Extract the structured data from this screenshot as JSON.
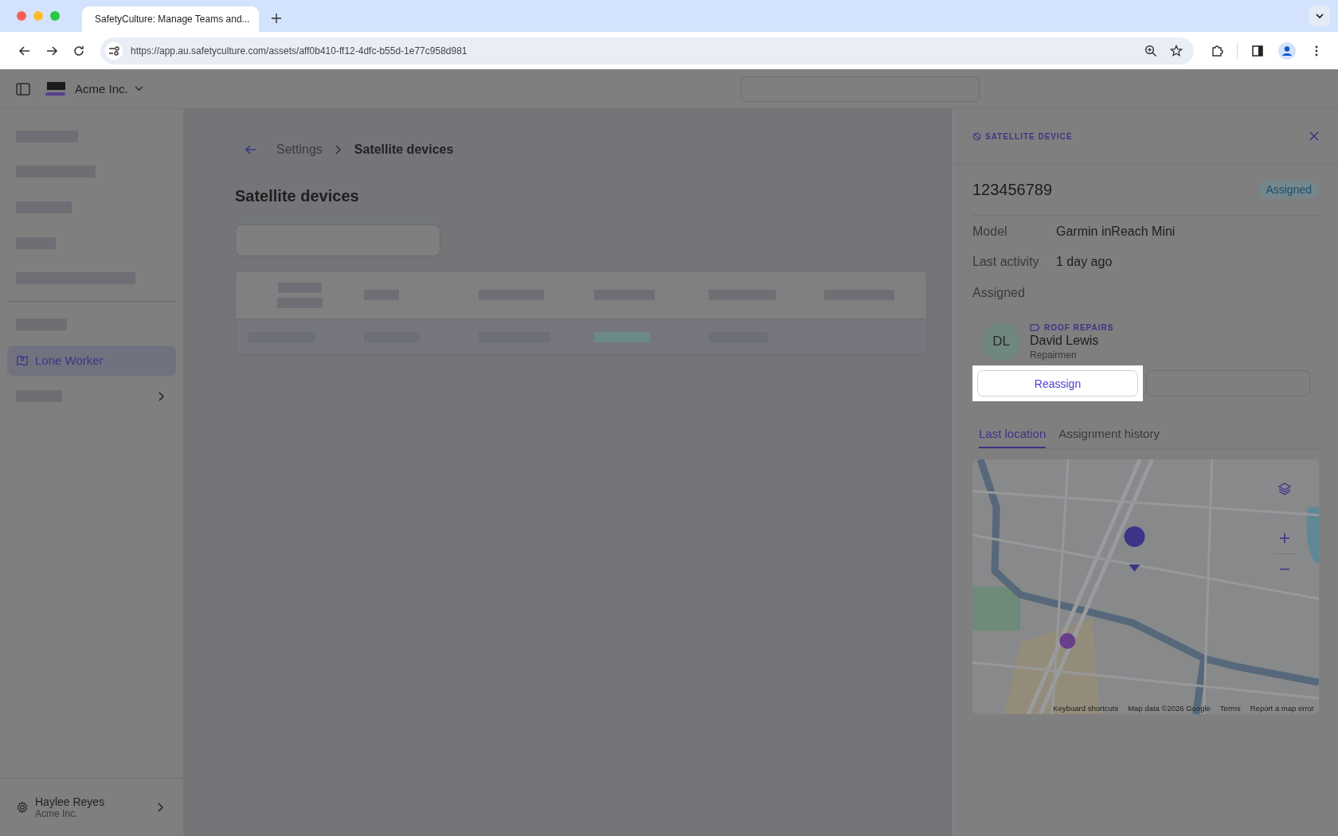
{
  "browser": {
    "tab_title": "SafetyCulture: Manage Teams and...",
    "url": "https://app.au.safetyculture.com/assets/aff0b410-ff12-4dfc-b55d-1e77c958d981"
  },
  "app_header": {
    "org": "Acme Inc."
  },
  "sidebar": {
    "items": [
      {
        "kind": "skeleton"
      },
      {
        "kind": "skeleton"
      },
      {
        "kind": "skeleton"
      },
      {
        "kind": "skeleton"
      },
      {
        "kind": "skeleton"
      },
      {
        "kind": "divider"
      },
      {
        "kind": "skeleton"
      },
      {
        "kind": "nav",
        "label": "Lone Worker",
        "selected": true
      },
      {
        "kind": "skeleton-expand"
      }
    ],
    "user": {
      "name": "Haylee Reyes",
      "org": "Acme Inc."
    }
  },
  "breadcrumb": [
    "Settings",
    "Satellite devices"
  ],
  "page_title": "Satellite devices",
  "panel": {
    "kicker": "SATELLITE DEVICE",
    "device_id": "123456789",
    "status": "Assigned",
    "fields": [
      {
        "label": "Model",
        "value": "Garmin inReach Mini"
      },
      {
        "label": "Last activity",
        "value": "1 day ago"
      }
    ],
    "assigned_heading": "Assigned",
    "assignee": {
      "initials": "DL",
      "group": "ROOF REPAIRS",
      "name": "David Lewis",
      "role": "Repairmen"
    },
    "primary_button": "Reassign",
    "tabs": [
      {
        "label": "Last location",
        "selected": true
      },
      {
        "label": "Assignment history",
        "selected": false
      }
    ],
    "map": {
      "kind": "picture",
      "footer": [
        "Keyboard shortcuts",
        "Map data ©2026 Google",
        "Terms",
        "Report a map error"
      ]
    }
  }
}
